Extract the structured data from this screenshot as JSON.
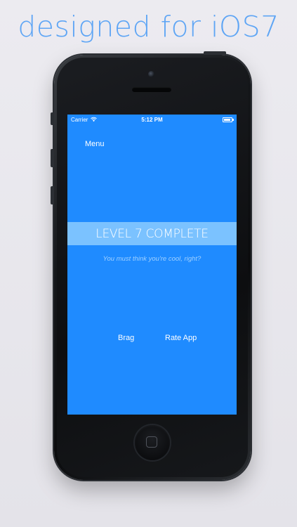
{
  "headline": "designed for iOS7",
  "status_bar": {
    "carrier": "Carrier",
    "time": "5:12 PM",
    "battery_level": 0.9,
    "wifi_icon": "wifi-icon",
    "battery_icon": "battery-icon"
  },
  "app": {
    "menu_label": "Menu",
    "level_title": "LEVEL 7 COMPLETE",
    "level_subtitle": "You must think you're cool, right?",
    "brag_label": "Brag",
    "rate_label": "Rate App"
  },
  "colors": {
    "screen_background": "#1f8bff",
    "banner_background": "#96d2ff",
    "headline_text": "#5ea5f5",
    "page_background": "#ecebf0"
  }
}
